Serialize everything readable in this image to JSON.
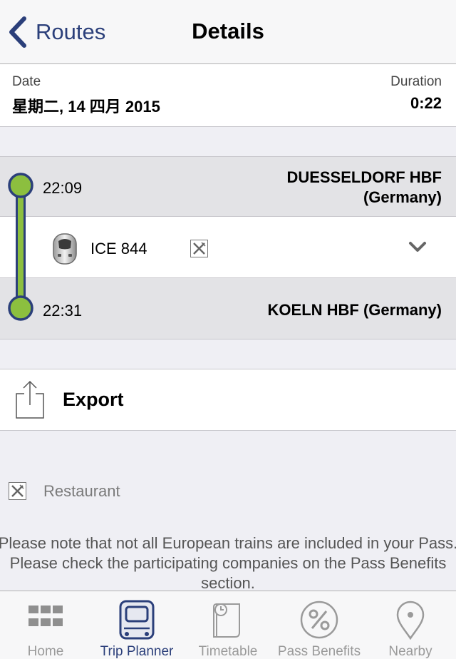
{
  "navbar": {
    "back_label": "Routes",
    "title": "Details"
  },
  "summary": {
    "date_label": "Date",
    "date_value": "星期二, 14 四月 2015",
    "duration_label": "Duration",
    "duration_value": "0:22"
  },
  "journey": {
    "departure": {
      "time": "22:09",
      "station": "DUESSELDORF HBF",
      "country": "(Germany)"
    },
    "train": {
      "name": "ICE 844",
      "icon": "train-icon",
      "amenity_icon": "restaurant-icon"
    },
    "arrival": {
      "time": "22:31",
      "station": "KOELN HBF (Germany)"
    }
  },
  "export": {
    "label": "Export",
    "icon": "share-icon"
  },
  "legend": {
    "icon": "restaurant-icon",
    "label": "Restaurant"
  },
  "note": "Please note that not all European trains are included in your Pass. Please check the participating companies on the Pass Benefits section.",
  "tabs": [
    {
      "label": "Home",
      "icon": "grid-icon",
      "active": false
    },
    {
      "label": "Trip Planner",
      "icon": "train-front-icon",
      "active": true
    },
    {
      "label": "Timetable",
      "icon": "timetable-icon",
      "active": false
    },
    {
      "label": "Pass Benefits",
      "icon": "percent-icon",
      "active": false
    },
    {
      "label": "Nearby",
      "icon": "location-pin-icon",
      "active": false
    }
  ],
  "colors": {
    "accent": "#2b3f7a",
    "route_line": "#8cbf3f",
    "tab_inactive": "#9a9a9a"
  }
}
